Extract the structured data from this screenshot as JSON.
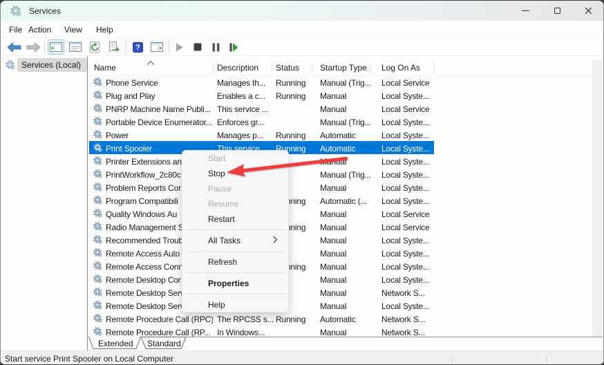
{
  "window": {
    "title": "Services"
  },
  "menubar": {
    "items": [
      "File",
      "Action",
      "View",
      "Help"
    ]
  },
  "toolbar": {
    "buttons": [
      "back",
      "forward",
      "show-console-tree",
      "properties-window",
      "refresh",
      "export-list",
      "help",
      "show-action-pane",
      "start-service",
      "stop-service",
      "pause-service",
      "restart-service"
    ]
  },
  "sidebar": {
    "root_label": "Services (Local)"
  },
  "table": {
    "columns": [
      "Name",
      "Description",
      "Status",
      "Startup Type",
      "Log On As"
    ],
    "rows": [
      {
        "name": "Phone Service",
        "description": "Manages th...",
        "status": "Running",
        "startup_type": "Manual (Trig...",
        "log_on_as": "Local Service",
        "selected": false
      },
      {
        "name": "Plug and Play",
        "description": "Enables a c...",
        "status": "Running",
        "startup_type": "Manual",
        "log_on_as": "Local Syste...",
        "selected": false
      },
      {
        "name": "PNRP Machine Name Publi...",
        "description": "This service ...",
        "status": "",
        "startup_type": "Manual",
        "log_on_as": "Local Service",
        "selected": false
      },
      {
        "name": "Portable Device Enumerator...",
        "description": "Enforces gr...",
        "status": "",
        "startup_type": "Manual (Trig...",
        "log_on_as": "Local Syste...",
        "selected": false
      },
      {
        "name": "Power",
        "description": "Manages p...",
        "status": "Running",
        "startup_type": "Automatic",
        "log_on_as": "Local Syste...",
        "selected": false
      },
      {
        "name": "Print Spooler",
        "description": "This service...",
        "status": "Running",
        "startup_type": "Automatic",
        "log_on_as": "Local Syste...",
        "selected": true
      },
      {
        "name": "Printer Extensions an",
        "description": "",
        "status": "",
        "startup_type": "Manual",
        "log_on_as": "Local Syste...",
        "selected": false
      },
      {
        "name": "PrintWorkflow_2c80c",
        "description": "",
        "status": "",
        "startup_type": "Manual (Trig...",
        "log_on_as": "Local Syste...",
        "selected": false
      },
      {
        "name": "Problem Reports Cor",
        "description": "",
        "status": "",
        "startup_type": "Manual",
        "log_on_as": "Local Syste...",
        "selected": false
      },
      {
        "name": "Program Compatibili",
        "description": "",
        "status": "Running",
        "startup_type": "Automatic (...",
        "log_on_as": "Local Syste...",
        "selected": false
      },
      {
        "name": "Quality Windows Au",
        "description": "",
        "status": "",
        "startup_type": "Manual",
        "log_on_as": "Local Service",
        "selected": false
      },
      {
        "name": "Radio Management S",
        "description": "",
        "status": "Running",
        "startup_type": "Manual",
        "log_on_as": "Local Service",
        "selected": false
      },
      {
        "name": "Recommended Troub",
        "description": "",
        "status": "",
        "startup_type": "Manual",
        "log_on_as": "Local Syste...",
        "selected": false
      },
      {
        "name": "Remote Access Auto",
        "description": "",
        "status": "",
        "startup_type": "Manual",
        "log_on_as": "Local Syste...",
        "selected": false
      },
      {
        "name": "Remote Access Conn",
        "description": "",
        "status": "Running",
        "startup_type": "Manual",
        "log_on_as": "Local Syste...",
        "selected": false
      },
      {
        "name": "Remote Desktop Cor",
        "description": "",
        "status": "",
        "startup_type": "Manual",
        "log_on_as": "Local Syste...",
        "selected": false
      },
      {
        "name": "Remote Desktop Serv",
        "description": "",
        "status": "",
        "startup_type": "Manual",
        "log_on_as": "Network S...",
        "selected": false
      },
      {
        "name": "Remote Desktop Serv",
        "description": "",
        "status": "",
        "startup_type": "Manual",
        "log_on_as": "Local Syste...",
        "selected": false
      },
      {
        "name": "Remote Procedure Call (RPC)",
        "description": "The RPCSS s...",
        "status": "Running",
        "startup_type": "Automatic",
        "log_on_as": "Network S...",
        "selected": false
      },
      {
        "name": "Remote Procedure Call (RP...",
        "description": "In Windows...",
        "status": "",
        "startup_type": "Manual",
        "log_on_as": "Network S...",
        "selected": false
      }
    ]
  },
  "context_menu": {
    "items": [
      {
        "label": "Start",
        "enabled": false
      },
      {
        "label": "Stop",
        "enabled": true
      },
      {
        "label": "Pause",
        "enabled": false
      },
      {
        "label": "Resume",
        "enabled": false
      },
      {
        "label": "Restart",
        "enabled": true
      },
      {
        "separator": true
      },
      {
        "label": "All Tasks",
        "enabled": true,
        "submenu": true
      },
      {
        "separator": true
      },
      {
        "label": "Refresh",
        "enabled": true
      },
      {
        "separator": true
      },
      {
        "label": "Properties",
        "enabled": true,
        "bold": true
      },
      {
        "separator": true
      },
      {
        "label": "Help",
        "enabled": true
      }
    ]
  },
  "tabs": {
    "items": [
      "Extended",
      "Standard"
    ],
    "active": "Extended"
  },
  "status_bar": {
    "text": "Start service Print Spooler on Local Computer"
  },
  "annotation": {
    "arrow_points_to": "Stop",
    "arrow_color": "#ef3d3d"
  },
  "colors": {
    "selection": "#0178d8",
    "title_bar_left": "#e8f9f4",
    "title_bar_right": "#e6e6e6"
  }
}
